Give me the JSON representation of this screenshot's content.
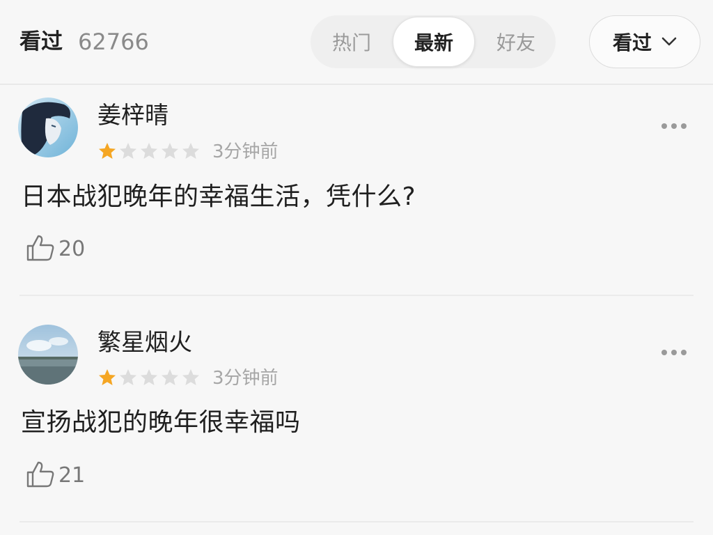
{
  "header": {
    "title": "看过",
    "count": "62766",
    "tabs": [
      {
        "label": "热门",
        "active": false
      },
      {
        "label": "最新",
        "active": true
      },
      {
        "label": "好友",
        "active": false
      }
    ],
    "filter_label": "看过",
    "filter_icon": "chevron-down-icon"
  },
  "comments": [
    {
      "username": "姜梓晴",
      "rating": 1,
      "rating_max": 5,
      "time": "3分钟前",
      "text": "日本战犯晚年的幸福生活，凭什么?",
      "likes": "20"
    },
    {
      "username": "繁星烟火",
      "rating": 1,
      "rating_max": 5,
      "time": "3分钟前",
      "text": "宣扬战犯的晚年很幸福吗",
      "likes": "21"
    }
  ],
  "colors": {
    "star_active": "#f5a623",
    "star_inactive": "#dcdcdc",
    "muted": "#a6a6a6"
  }
}
